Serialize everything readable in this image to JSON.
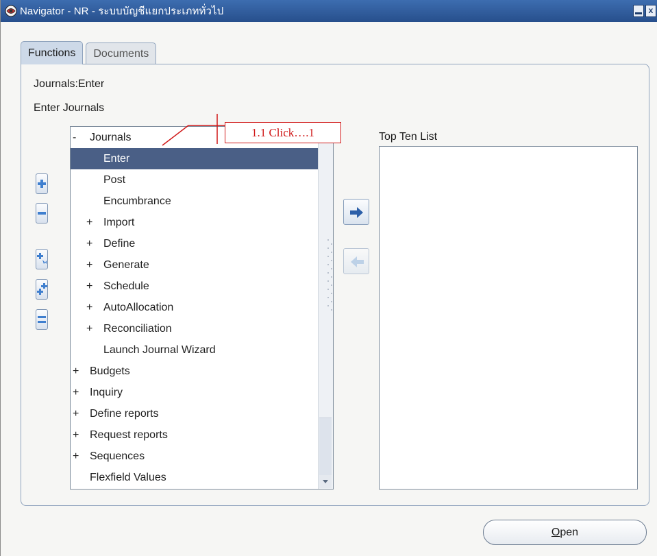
{
  "window": {
    "title": "Navigator - NR - ระบบบัญชีแยกประเภททั่วไป",
    "minimize_label": "",
    "close_label": "x"
  },
  "tabs": [
    {
      "label": "Functions",
      "active": true
    },
    {
      "label": "Documents",
      "active": false
    }
  ],
  "path_label": "Journals:Enter",
  "description_label": "Enter Journals",
  "tree": {
    "items": [
      {
        "prefix": "-",
        "label": "Journals",
        "level": 0
      },
      {
        "prefix": "",
        "label": "Enter",
        "level": 1,
        "selected": true
      },
      {
        "prefix": "",
        "label": "Post",
        "level": 1
      },
      {
        "prefix": "",
        "label": "Encumbrance",
        "level": 1
      },
      {
        "prefix": "+",
        "label": "Import",
        "level": 1
      },
      {
        "prefix": "+",
        "label": "Define",
        "level": 1
      },
      {
        "prefix": "+",
        "label": "Generate",
        "level": 1
      },
      {
        "prefix": "+",
        "label": "Schedule",
        "level": 1
      },
      {
        "prefix": "+",
        "label": "AutoAllocation",
        "level": 1
      },
      {
        "prefix": "+",
        "label": "Reconciliation",
        "level": 1
      },
      {
        "prefix": "",
        "label": "Launch Journal Wizard",
        "level": 1
      },
      {
        "prefix": "+",
        "label": "Budgets",
        "level": 0
      },
      {
        "prefix": "+",
        "label": "Inquiry",
        "level": 0
      },
      {
        "prefix": "+",
        "label": "Define reports",
        "level": 0
      },
      {
        "prefix": "+",
        "label": "Request reports",
        "level": 0
      },
      {
        "prefix": "+",
        "label": "Sequences",
        "level": 0
      },
      {
        "prefix": "",
        "label": "Flexfield Values",
        "level": 0
      }
    ]
  },
  "top_ten": {
    "label": "Top Ten List",
    "items": []
  },
  "open_button": {
    "accel": "O",
    "rest": "pen"
  },
  "callout": {
    "text": "1.1 Click….1"
  },
  "colors": {
    "selection": "#4a5f86",
    "callout": "#d01818",
    "titlebar": "#2f5c9c"
  }
}
